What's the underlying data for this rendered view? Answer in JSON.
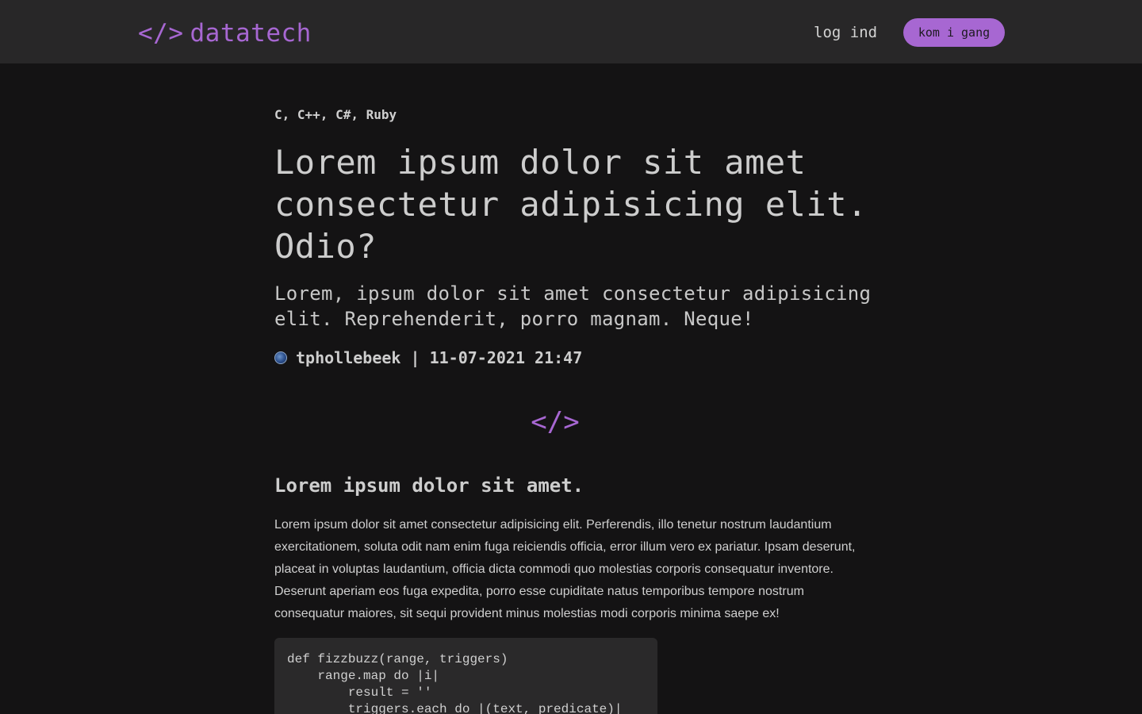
{
  "navbar": {
    "logo_mark": "</>",
    "logo_text": "datatech",
    "login_label": "log ind",
    "cta_label": "kom i gang"
  },
  "article": {
    "tags": "C, C++, C#, Ruby",
    "title": "Lorem ipsum dolor sit amet consectetur adipisicing elit. Odio?",
    "subtitle": "Lorem, ipsum dolor sit amet consectetur adipisicing elit. Reprehenderit, porro magnam. Neque!",
    "meta": "tphollebeek | 11-07-2021 21:47",
    "divider_icon": "</>",
    "section_heading": "Lorem ipsum dolor sit amet.",
    "paragraph": "Lorem ipsum dolor sit amet consectetur adipisicing elit. Perferendis, illo tenetur nostrum laudantium exercitationem, soluta odit nam enim fuga reiciendis officia, error illum vero ex pariatur. Ipsam deserunt, placeat in voluptas laudantium, officia dicta commodi quo molestias corporis consequatur inventore. Deserunt aperiam eos fuga expedita, porro esse cupiditate natus temporibus tempore nostrum consequatur maiores, sit sequi provident minus molestias modi corporis minima saepe ex!",
    "code_lines": [
      "def fizzbuzz(range, triggers)",
      "    range.map do |i|",
      "        result = ''",
      "        triggers.each do |(text, predicate)|"
    ]
  },
  "colors": {
    "accent": "#a767d2",
    "navbar_bg": "#282728",
    "page_bg": "#141314",
    "code_bg": "#2a292a"
  }
}
